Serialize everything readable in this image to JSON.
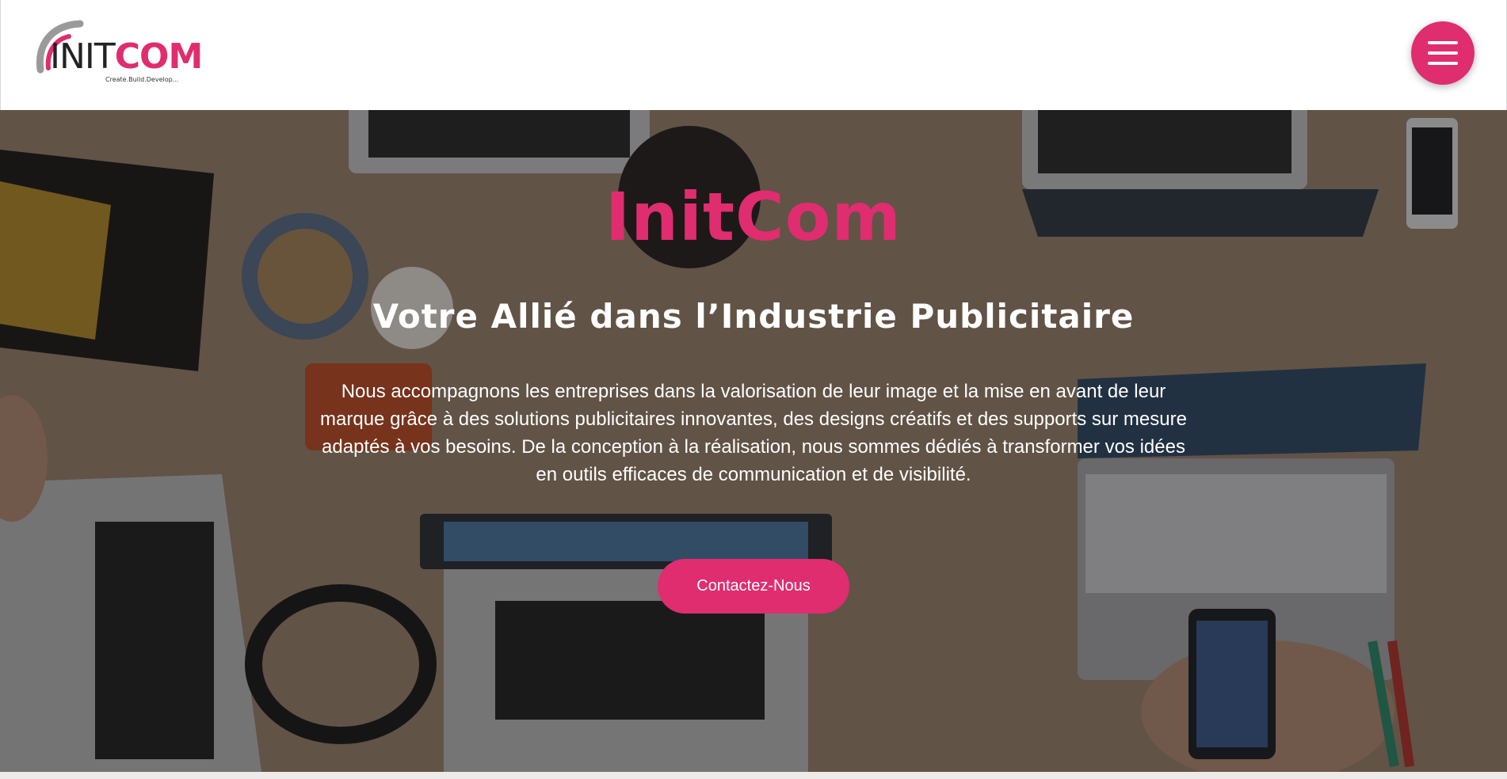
{
  "header": {
    "logo": {
      "word_init": "INIT",
      "word_com": "COM",
      "tagline": "Create.Build.Develop..."
    },
    "menu_button": {
      "icon": "hamburger-icon"
    }
  },
  "hero": {
    "title": "InitCom",
    "subtitle": "Votre Allié dans l’Industrie Publicitaire",
    "description": "Nous accompagnons les entreprises dans la valorisation de leur image et la mise en avant de leur marque grâce à des solutions publicitaires innovantes, des designs créatifs et des supports sur mesure adaptés à vos besoins. De la conception à la réalisation, nous sommes dédiés à transformer vos idées en outils efficaces de communication et de visibilité.",
    "cta_label": "Contactez-Nous",
    "background_image": "office-desk-laptops-photo"
  },
  "colors": {
    "accent": "#df2d6f",
    "header_bg": "#ffffff",
    "text_on_hero": "#ffffff",
    "logo_arc": "#9a9a9a"
  }
}
